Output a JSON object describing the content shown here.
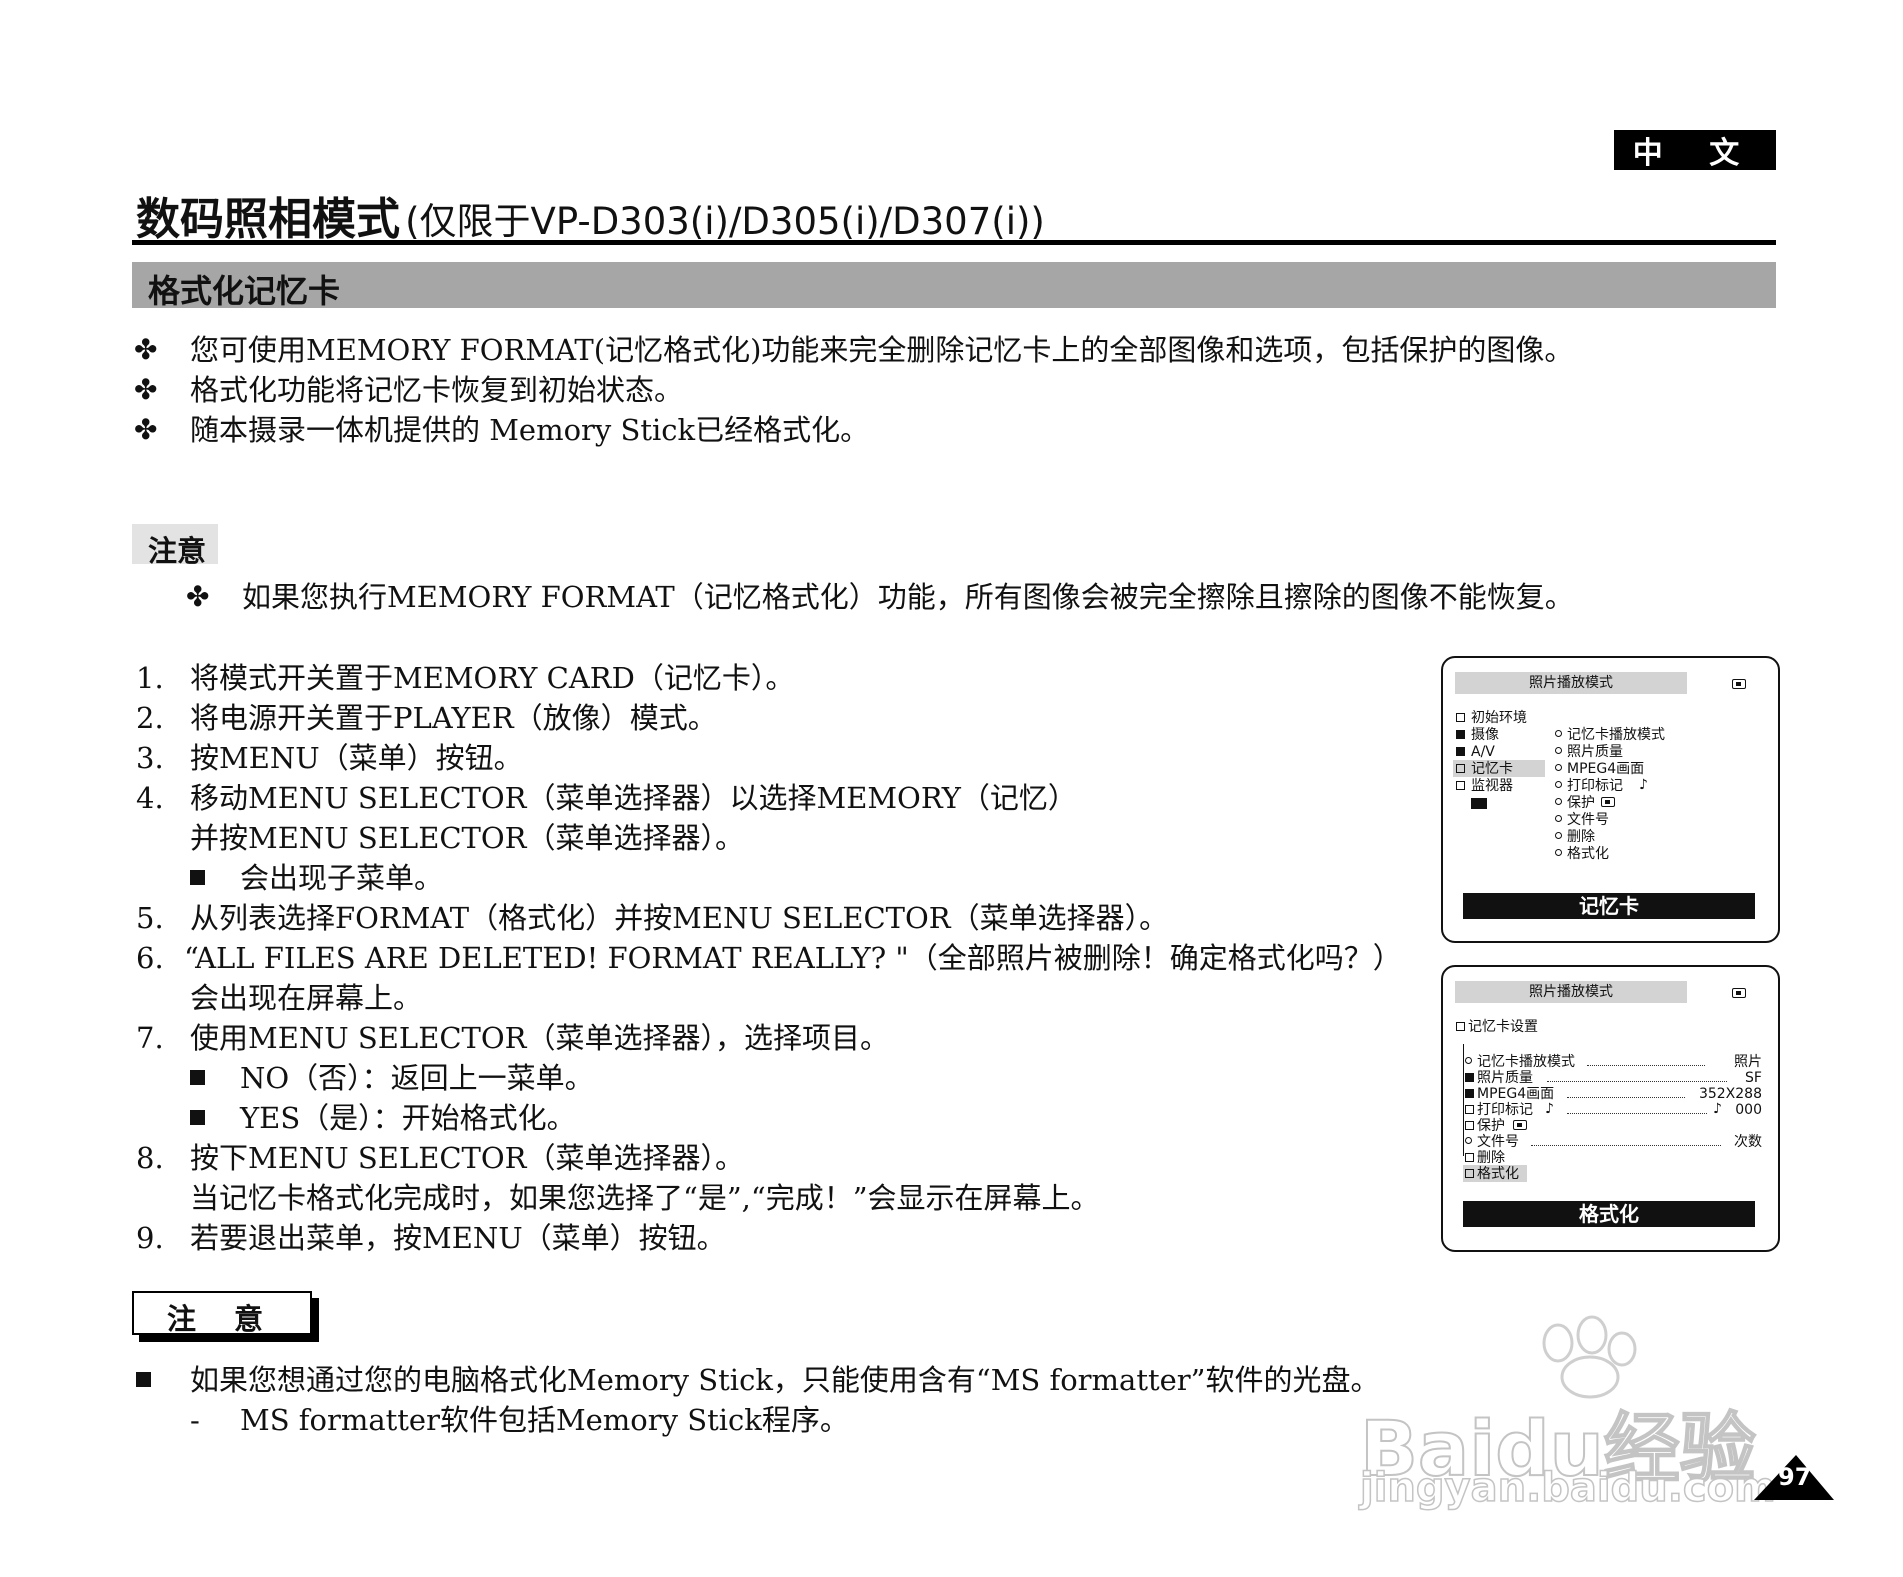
{
  "header": {
    "language_badge": "中 文",
    "title_main": "数码照相模式",
    "title_sub": "(仅限于VP-D303(i)/D305(i)/D307(i))"
  },
  "section": {
    "title": "格式化记忆卡"
  },
  "intro_bullets": [
    "您可使用MEMORY FORMAT(记忆格式化)功能来完全删除记忆卡上的全部图像和选项，包括保护的图像。",
    "格式化功能将记忆卡恢复到初始状态。",
    "随本摄录一体机提供的 Memory Stick已经格式化。"
  ],
  "note_top": {
    "label": "注意",
    "text": "如果您执行MEMORY FORMAT（记忆格式化）功能，所有图像会被完全擦除且擦除的图像不能恢复。"
  },
  "steps": {
    "s1": {
      "num": "1.",
      "text": "将模式开关置于MEMORY CARD（记忆卡）。"
    },
    "s2": {
      "num": "2.",
      "text": "将电源开关置于PLAYER（放像）模式。"
    },
    "s3": {
      "num": "3.",
      "text": "按MENU（菜单）按钮。"
    },
    "s4": {
      "num": "4.",
      "text": "移动MENU SELECTOR（菜单选择器）以选择MEMORY（记忆）",
      "text2": "并按MENU SELECTOR（菜单选择器）。",
      "sub": "会出现子菜单。"
    },
    "s5": {
      "num": "5.",
      "text": "从列表选择FORMAT（格式化）并按MENU SELECTOR（菜单选择器）。"
    },
    "s6": {
      "num": "6.",
      "text": "“ALL FILES ARE DELETED! FORMAT REALLY? \"（全部照片被删除！确定格式化吗？）",
      "text2": "会出现在屏幕上。"
    },
    "s7": {
      "num": "7.",
      "text": "使用MENU SELECTOR（菜单选择器），选择项目。",
      "sub1": "NO（否）：返回上一菜单。",
      "sub2": "YES（是）：开始格式化。"
    },
    "s8": {
      "num": "8.",
      "text": "按下MENU SELECTOR（菜单选择器）。",
      "text2": "当记忆卡格式化完成时，如果您选择了“是”,“完成！”会显示在屏幕上。"
    },
    "s9": {
      "num": "9.",
      "text": "若要退出菜单，按MENU（菜单）按钮。"
    }
  },
  "note_bottom": {
    "label": "注 意",
    "text": "如果您想通过您的电脑格式化Memory Stick，只能使用含有“MS formatter”软件的光盘。",
    "dash": "-",
    "sub": "MS formatter软件包括Memory Stick程序。"
  },
  "screen1": {
    "header": "照片播放模式",
    "left_menu": [
      "初始环境",
      "摄像",
      "A/V",
      "记忆卡",
      "监视器"
    ],
    "right_menu": [
      "记忆卡播放模式",
      "照片质量",
      "MPEG4画面",
      "打印标记",
      "保护",
      "文件号",
      "删除",
      "格式化"
    ],
    "footer": "记忆卡"
  },
  "screen2": {
    "header": "照片播放模式",
    "group": "记忆卡设置",
    "rows": [
      {
        "label": "记忆卡播放模式",
        "value": "照片"
      },
      {
        "label": "照片质量",
        "value": "SF"
      },
      {
        "label": "MPEG4画面",
        "value": "352X288"
      },
      {
        "label": "打印标记",
        "value": "000"
      },
      {
        "label": "保护",
        "value": ""
      },
      {
        "label": "文件号",
        "value": "次数"
      },
      {
        "label": "删除",
        "value": ""
      },
      {
        "label": "格式化",
        "value": ""
      }
    ],
    "footer": "格式化"
  },
  "watermark": {
    "brand": "Bai",
    "brand2": "du",
    "brand3": "经验",
    "url": "jingyan.baidu.com"
  },
  "page": {
    "number": "97"
  }
}
